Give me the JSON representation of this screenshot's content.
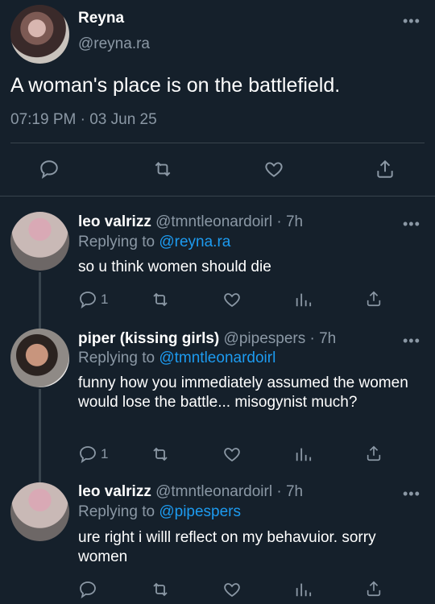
{
  "main_tweet": {
    "name": "Reyna",
    "handle": "@reyna.ra",
    "text": "A woman's place is on the battlefield.",
    "timestamp": "07:19 PM · 03 Jun 25"
  },
  "replies": [
    {
      "name": "leo valrizz",
      "handle_time": "@tmntleonardoirl · 7h",
      "replying_prefix": "Replying to ",
      "replying_to": "@reyna.ra",
      "text": "so u think women should die",
      "reply_count": "1"
    },
    {
      "name": "piper (kissing girls)",
      "handle_time": "@pipespers · 7h",
      "replying_prefix": "Replying to ",
      "replying_to": "@tmntleonardoirl",
      "text": "funny how you immediately assumed the women would lose the battle... misogynist much?",
      "reply_count": "1"
    },
    {
      "name": "leo valrizz",
      "handle_time": "@tmntleonardoirl · 7h",
      "replying_prefix": "Replying to ",
      "replying_to": "@pipespers",
      "text": "ure right i willl reflect on my behavuior. sorry women",
      "reply_count": ""
    }
  ],
  "icons": {
    "more": "more-icon",
    "reply": "reply-icon",
    "retweet": "retweet-icon",
    "like": "like-icon",
    "share": "share-icon",
    "analytics": "analytics-icon"
  },
  "colors": {
    "background": "#15202b",
    "secondary_text": "#8b98a5",
    "link": "#1d9bf0",
    "divider": "#38444d"
  }
}
